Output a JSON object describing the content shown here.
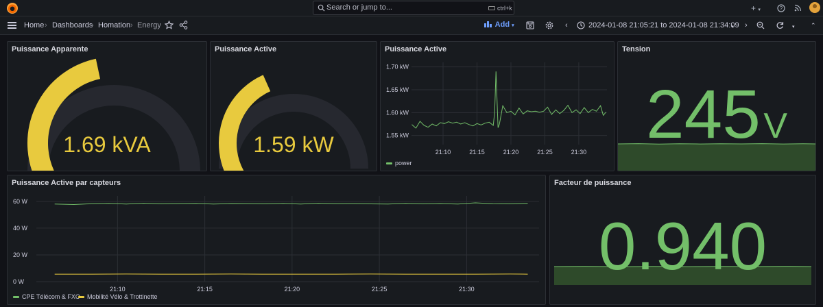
{
  "topbar": {
    "search_placeholder": "Search or jump to...",
    "search_shortcut": "ctrl+k",
    "plus_label": "+",
    "help_icon": "?",
    "news_icon": "rss"
  },
  "breadcrumb": {
    "home": "Home",
    "dashboards": "Dashboards",
    "folder": "Homation",
    "current": "Energy"
  },
  "toolbar": {
    "add_label": "Add",
    "time_range": "2024-01-08 21:05:21 to 2024-01-08 21:34:09"
  },
  "colors": {
    "yellow": "#e8ca3e",
    "green": "#73bf69",
    "gauge_track": "#26282f"
  },
  "panels": {
    "apparent": {
      "title": "Puissance Apparente",
      "value": "1.69 kVA",
      "fill": 0.45
    },
    "active_gauge": {
      "title": "Puissance Active",
      "value": "1.59 kW",
      "fill": 0.4
    },
    "active_graph": {
      "title": "Puissance Active",
      "legend": "power",
      "chart_data": {
        "type": "line",
        "ylim": [
          1.53,
          1.71
        ],
        "y_ticks": [
          "1.70 kW",
          "1.65 kW",
          "1.60 kW",
          "1.55 kW"
        ],
        "y_tick_values": [
          1.7,
          1.65,
          1.6,
          1.55
        ],
        "x_ticks": [
          "21:10",
          "21:15",
          "21:20",
          "21:25",
          "21:30"
        ],
        "x_tick_values": [
          10,
          15,
          20,
          25,
          30
        ],
        "xlim": [
          5.35,
          34.15
        ],
        "series": [
          {
            "name": "power",
            "x": [
              5.4,
              6.0,
              6.6,
              7.2,
              7.8,
              8.4,
              9.0,
              9.6,
              10.2,
              10.8,
              11.4,
              12.0,
              12.6,
              13.2,
              13.8,
              14.4,
              15.0,
              15.6,
              16.2,
              16.8,
              17.4,
              17.6,
              17.8,
              18.1,
              18.3,
              18.8,
              19.4,
              20.0,
              20.6,
              21.2,
              21.8,
              22.4,
              23.0,
              23.6,
              24.2,
              24.8,
              25.4,
              26.0,
              26.6,
              27.2,
              27.8,
              28.4,
              29.0,
              29.6,
              30.2,
              30.8,
              31.4,
              32.0,
              32.6,
              33.2,
              33.6,
              34.0
            ],
            "y": [
              1.574,
              1.566,
              1.581,
              1.572,
              1.568,
              1.575,
              1.571,
              1.578,
              1.576,
              1.58,
              1.577,
              1.579,
              1.575,
              1.578,
              1.574,
              1.571,
              1.576,
              1.573,
              1.577,
              1.579,
              1.572,
              1.6,
              1.69,
              1.567,
              1.575,
              1.615,
              1.6,
              1.603,
              1.595,
              1.61,
              1.597,
              1.604,
              1.602,
              1.603,
              1.601,
              1.603,
              1.612,
              1.596,
              1.606,
              1.598,
              1.605,
              1.616,
              1.6,
              1.606,
              1.598,
              1.611,
              1.6,
              1.607,
              1.603,
              1.615,
              1.594,
              1.601
            ]
          }
        ]
      }
    },
    "tension": {
      "title": "Tension",
      "value": "245",
      "unit": "V"
    },
    "sensors": {
      "title": "Puissance Active par capteurs",
      "chart_data": {
        "type": "line",
        "ylim": [
          0,
          64
        ],
        "y_ticks": [
          "60 W",
          "40 W",
          "20 W",
          "0 W"
        ],
        "y_tick_values": [
          60,
          40,
          20,
          0
        ],
        "x_ticks": [
          "21:10",
          "21:15",
          "21:20",
          "21:25",
          "21:30"
        ],
        "x_tick_values": [
          10,
          15,
          20,
          25,
          30
        ],
        "xlim": [
          5.35,
          34.15
        ],
        "series": [
          {
            "name": "CPE Télécom & FXO",
            "color": "#73bf69",
            "x": [
              6.4,
              7.5,
              8.5,
              9.5,
              10.5,
              11.5,
              12.5,
              13.5,
              14.5,
              15.5,
              16.5,
              17.5,
              18.5,
              19.5,
              20.5,
              21.5,
              22.5,
              23.5,
              24.5,
              25.5,
              26.5,
              27.5,
              28.5,
              29.5,
              30.5,
              31.5,
              32.5,
              33.5
            ],
            "y": [
              58.0,
              57.6,
              58.2,
              58.5,
              58.0,
              58.6,
              58.1,
              58.3,
              58.4,
              58.0,
              58.3,
              58.2,
              58.1,
              58.4,
              58.0,
              58.6,
              58.2,
              58.3,
              58.1,
              58.0,
              58.5,
              58.1,
              58.3,
              58.0,
              58.9,
              58.2,
              58.1,
              58.5
            ]
          },
          {
            "name": "Mobilité Vélo & Trottinette",
            "color": "#e8ca3e",
            "x": [
              6.4,
              8.5,
              10.5,
              12.5,
              14.5,
              16.5,
              18.5,
              20.5,
              22.5,
              24.5,
              26.5,
              28.5,
              30.5,
              32.5,
              33.5
            ],
            "y": [
              5.6,
              5.6,
              5.7,
              5.6,
              5.6,
              5.7,
              5.6,
              5.6,
              5.6,
              5.7,
              5.6,
              5.6,
              5.6,
              5.7,
              5.6
            ]
          }
        ]
      }
    },
    "power_factor": {
      "title": "Facteur de puissance",
      "value": "0.940"
    }
  }
}
